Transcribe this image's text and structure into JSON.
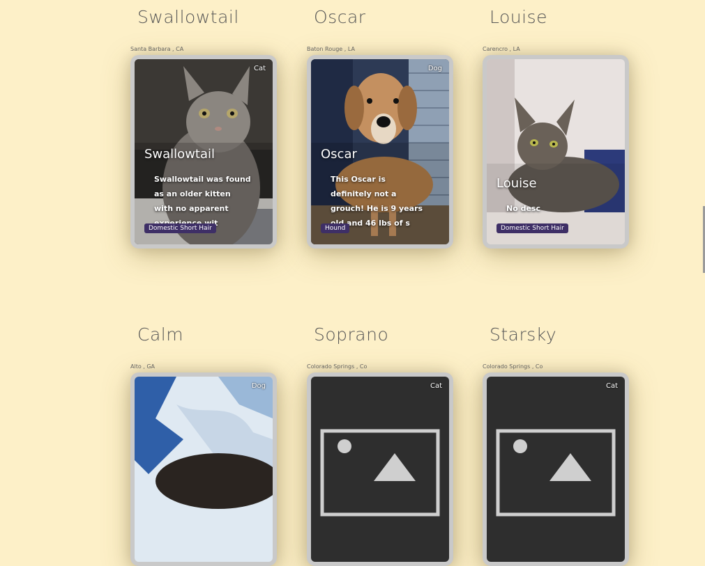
{
  "pets": [
    {
      "title": "Swallowtail",
      "location": "Santa Barbara , CA",
      "species": "Cat",
      "name": "Swallowtail",
      "description": "Swallowtail was found as an older kitten with no apparent experience wit",
      "breed": "Domestic Short Hair"
    },
    {
      "title": "Oscar",
      "location": "Baton Rouge , LA",
      "species": "Dog",
      "name": "Oscar",
      "description": "This Oscar is definitely not a grouch! He is 9 years old and 46 lbs of s",
      "breed": "Hound"
    },
    {
      "title": "Louise",
      "location": "Carencro , LA",
      "species": "",
      "name": "Louise",
      "description": "No desc",
      "breed": "Domestic Short Hair"
    },
    {
      "title": "Calm",
      "location": "Alto , GA",
      "species": "Dog",
      "name": "Calm",
      "description": "",
      "breed": ""
    },
    {
      "title": "Soprano",
      "location": "Colorado Springs , Co",
      "species": "Cat",
      "name": "Soprano",
      "description": "",
      "breed": ""
    },
    {
      "title": "Starsky",
      "location": "Colorado Springs , Co",
      "species": "Cat",
      "name": "Starsky",
      "description": "",
      "breed": ""
    }
  ],
  "colors": {
    "background": "#fdf0c8",
    "breed_badge": "#3e2f66",
    "frame": "#c9c9c9"
  }
}
